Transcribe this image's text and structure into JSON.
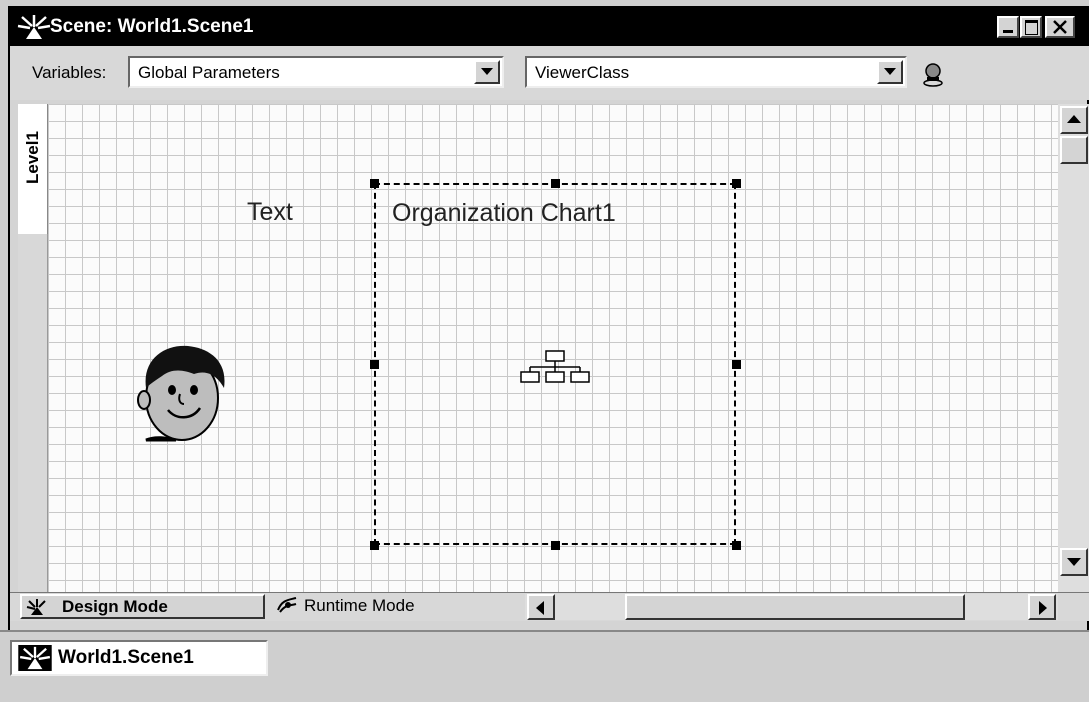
{
  "window": {
    "title": "Scene: World1.Scene1"
  },
  "toolbar": {
    "variables_label": "Variables:",
    "variables_value": "Global Parameters",
    "class_value": "ViewerClass"
  },
  "side_tab": {
    "label": "Level1"
  },
  "canvas": {
    "text_label": "Text",
    "chart_label": "Organization Chart1"
  },
  "modes": {
    "design": "Design Mode",
    "runtime": "Runtime Mode"
  },
  "taskbar": {
    "scene_button": "World1.Scene1"
  },
  "icons": [
    "app-icon",
    "minimize-icon",
    "maximize-icon",
    "close-icon",
    "connect-icon",
    "avatar-face-icon",
    "org-chart-icon",
    "design-mode-icon",
    "runtime-mode-icon"
  ]
}
